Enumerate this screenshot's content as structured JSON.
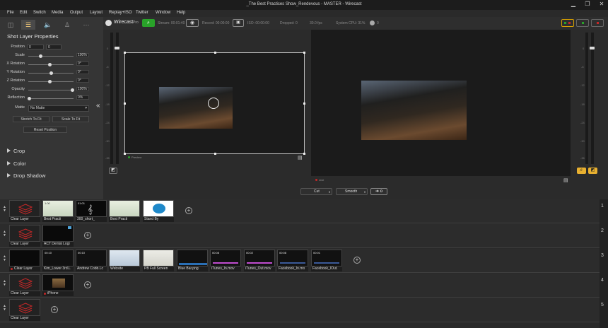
{
  "window": {
    "title": "_The Best Practices Show_Rendevous - MASTER - Wirecast",
    "controls": [
      "▁",
      "❐",
      "✕"
    ]
  },
  "menu": [
    "File",
    "Edit",
    "Switch",
    "Media",
    "Output",
    "Layout",
    "Replay+ISO",
    "Twitter",
    "Window",
    "Help"
  ],
  "left_panel": {
    "title": "Shot Layer Properties",
    "position": {
      "label": "Position",
      "x": "0",
      "y": "0"
    },
    "sliders": [
      {
        "label": "Scale",
        "value": "100%",
        "level": 0.27
      },
      {
        "label": "X Rotation",
        "value": "0°",
        "level": 0.48
      },
      {
        "label": "Y Rotation",
        "value": "0°",
        "level": 0.5
      },
      {
        "label": "Z Rotation",
        "value": "0°",
        "level": 0.48
      },
      {
        "label": "Opacity",
        "value": "100%",
        "level": 0.98
      },
      {
        "label": "Reflection",
        "value": "0%",
        "level": 0.02
      }
    ],
    "matte": {
      "label": "Matte",
      "value": "No Matte"
    },
    "buttons": {
      "stretch": "Stretch To Fit",
      "scale": "Scale To Fit",
      "reset": "Reset Position"
    },
    "sections": [
      "Crop",
      "Color",
      "Drop Shadow"
    ]
  },
  "topbar": {
    "brand": "Wirecast",
    "brand_suffix": "Pro",
    "stats": {
      "stream": "Stream: 00:01:40",
      "record": "Record: 00:00:00",
      "iso": "ISO: 00:00:00",
      "dropped": "Dropped: 0",
      "fps": "30.0 fps",
      "cpu": "System CPU: 31%",
      "zero": "0"
    }
  },
  "preview": {
    "label": "Preview"
  },
  "live": {
    "label": "Live"
  },
  "meter_ticks": [
    "0",
    "-6",
    "-12",
    "-18",
    "-24",
    "-30",
    "-36"
  ],
  "transitions": {
    "cut": "Cut",
    "smooth": "Smooth",
    "go_symbol": "➔ o"
  },
  "layers": [
    {
      "number": "1",
      "shots": [
        {
          "name": "Clear Layer",
          "duration": ""
        },
        {
          "name": "Best Practi",
          "duration": "1:00"
        },
        {
          "name": "300_short_",
          "duration": "01:01"
        },
        {
          "name": "Best Practi",
          "duration": ""
        },
        {
          "name": "Stand By",
          "duration": ""
        }
      ]
    },
    {
      "number": "2",
      "shots": [
        {
          "name": "Clear Layer",
          "duration": ""
        },
        {
          "name": "ACT Dental Logi",
          "duration": ""
        }
      ]
    },
    {
      "number": "3",
      "shots": [
        {
          "name": "Clear Layer",
          "duration": ""
        },
        {
          "name": "Kim_Lower 3rd.L",
          "duration": "00:10"
        },
        {
          "name": "Andrew Cobb.Lc",
          "duration": "00:10"
        },
        {
          "name": "Website",
          "duration": ""
        },
        {
          "name": "PB Full Screen",
          "duration": ""
        },
        {
          "name": "Blue Bar.png",
          "duration": ""
        },
        {
          "name": "iTunes_In.mov",
          "duration": "00:08"
        },
        {
          "name": "iTunes_Out.mov",
          "duration": "00:02"
        },
        {
          "name": "Facebook_In.mo",
          "duration": "00:08"
        },
        {
          "name": "Facebook_IOut.",
          "duration": "00:01"
        }
      ]
    },
    {
      "number": "4",
      "shots": [
        {
          "name": "Clear Layer",
          "duration": ""
        },
        {
          "name": "iPhone",
          "duration": ""
        }
      ]
    },
    {
      "number": "5",
      "shots": [
        {
          "name": "Clear Layer",
          "duration": ""
        }
      ]
    }
  ],
  "colors": {
    "accent": "#f2c97a",
    "live_green": "#29a329",
    "live_red": "#c62828"
  }
}
